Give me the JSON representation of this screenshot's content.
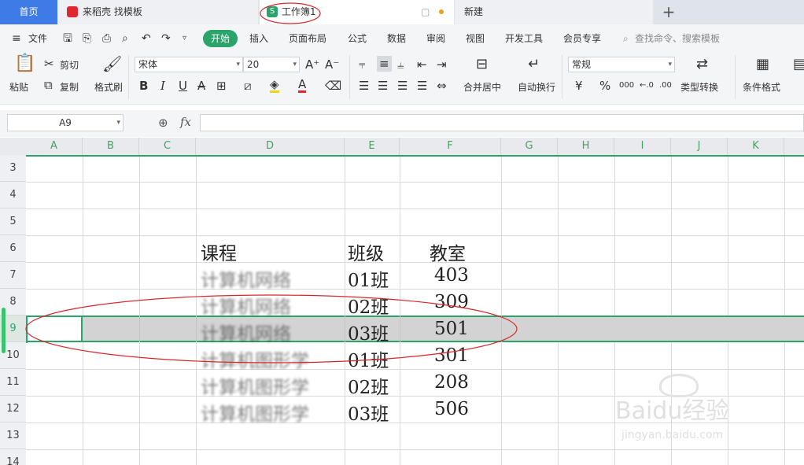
{
  "tabs": {
    "home": "首页",
    "daoke": "来稻壳 找模板",
    "workbook": "工作簿1",
    "new": "新建",
    "add": "+"
  },
  "menu": {
    "file": "文件",
    "items": [
      "开始",
      "插入",
      "页面布局",
      "公式",
      "数据",
      "审阅",
      "视图",
      "开发工具",
      "会员专享"
    ],
    "search": "查找命令、搜索模板"
  },
  "ribbon": {
    "paste": "粘贴",
    "cut": "剪切",
    "copy": "复制",
    "format_painter": "格式刷",
    "font_name": "宋体",
    "font_size": "20",
    "bold": "B",
    "italic": "I",
    "underline": "U",
    "merge_center": "合并居中",
    "wrap": "自动换行",
    "number_format": "常规",
    "currency": "¥",
    "percent": "%",
    "thousands": "000",
    "type_convert": "类型转换",
    "conditional": "条件格式"
  },
  "formula_bar": {
    "cell_ref": "A9",
    "fx": "fx",
    "value": ""
  },
  "columns": [
    "A",
    "B",
    "C",
    "D",
    "E",
    "F",
    "G",
    "H",
    "I",
    "J",
    "K"
  ],
  "rows": [
    "3",
    "4",
    "5",
    "6",
    "7",
    "8",
    "9",
    "10",
    "11",
    "12",
    "13",
    "14"
  ],
  "table": {
    "header": [
      "课程",
      "班级",
      "教室"
    ],
    "rows": [
      [
        "计算机网络",
        "01班",
        "403"
      ],
      [
        "计算机网络",
        "02班",
        "309"
      ],
      [
        "计算机网络",
        "03班",
        "501"
      ],
      [
        "计算机图形学",
        "01班",
        "301"
      ],
      [
        "计算机图形学",
        "02班",
        "208"
      ],
      [
        "计算机图形学",
        "03班",
        "506"
      ]
    ]
  },
  "watermark": {
    "brand": "Baidu经验",
    "url": "jingyan.baidu.com"
  },
  "colors": {
    "accent_green": "#2aa46b",
    "home_tab_blue": "#3f7be6",
    "annotation_red": "#d9262b"
  }
}
